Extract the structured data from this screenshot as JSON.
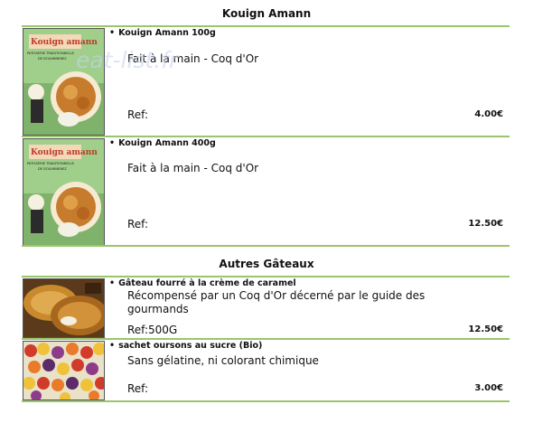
{
  "sections": [
    {
      "title": "Kouign Amann",
      "products": [
        {
          "name": "Kouign Amann 100g",
          "description": "Fait à la main - Coq d'Or",
          "ref": "Ref:",
          "price": "4.00€",
          "image": "kouign-amann-package-photo",
          "image_text": [
            "Kouign amann",
            "PATISSERIE TRADITIONNELLE",
            "DE DOUARNENEZ"
          ]
        },
        {
          "name": "Kouign Amann 400g",
          "description": "Fait à la main - Coq d'Or",
          "ref": "Ref:",
          "price": "12.50€",
          "image": "kouign-amann-package-photo",
          "image_text": [
            "Kouign amann",
            "PATISSERIE TRADITIONNELLE",
            "DE DOUARNENEZ"
          ]
        }
      ]
    },
    {
      "title": "Autres Gâteaux",
      "products": [
        {
          "name": "Gâteau fourré à la crème de caramel",
          "description": "Récompensé par un Coq d'Or décerné par le guide des gourmands",
          "ref": "Ref:500G",
          "price": "12.50€",
          "image": "caramel-cake-photo"
        },
        {
          "name": "sachet oursons au sucre (Bio)",
          "description": "Sans gélatine, ni colorant chimique",
          "ref": "Ref:",
          "price": "3.00€",
          "image": "gummy-bears-photo"
        }
      ]
    }
  ],
  "watermark": "eat-list.fr",
  "colors": {
    "rule": "#9bc56a",
    "text": "#111111",
    "background": "#ffffff"
  }
}
